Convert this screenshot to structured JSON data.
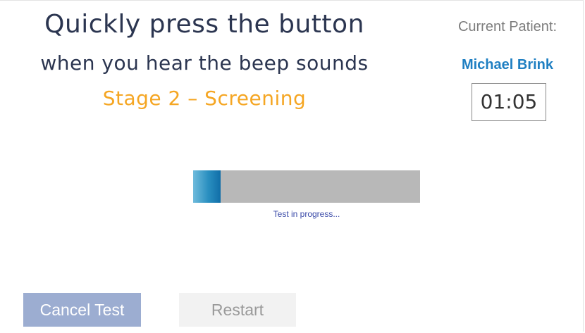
{
  "instructions": {
    "line1": "Quickly press the button",
    "line2": "when you hear the beep sounds",
    "stage": "Stage 2 – Screening"
  },
  "patient": {
    "label": "Current Patient:",
    "name": "Michael Brink",
    "timer": "01:05"
  },
  "progress": {
    "fraction": 0.12,
    "status": "Test in progress..."
  },
  "buttons": {
    "cancel": "Cancel Test",
    "restart": "Restart"
  },
  "colors": {
    "title_text": "#2b3550",
    "stage_text": "#f5a623",
    "patient_name": "#1f7fc2",
    "patient_label": "#7d7d7d",
    "progress_fill": "#2a8fc0",
    "progress_track": "#b8b8b8",
    "status_text": "#3a4aa8",
    "cancel_bg": "#9cadd1",
    "restart_bg": "#f2f2f2"
  }
}
